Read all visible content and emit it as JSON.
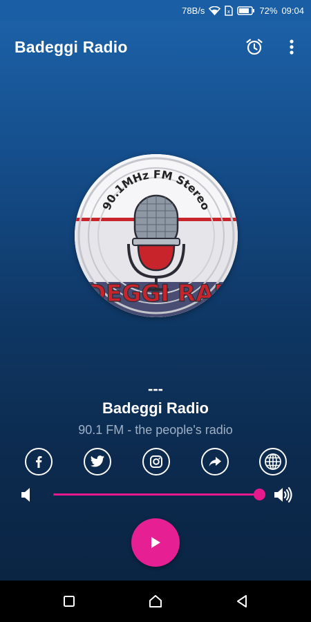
{
  "status_bar": {
    "speed": "78B/s",
    "battery": "72%",
    "time": "09:04"
  },
  "app_bar": {
    "title": "Badeggi Radio",
    "alarm_icon": "alarm-clock-icon",
    "menu_icon": "more-vert-icon"
  },
  "logo": {
    "ring_text": "90.1MHz FM Stereo",
    "wordmark": "BADEGGI RADIO"
  },
  "now_playing": {
    "track": "---",
    "station": "Badeggi Radio",
    "tagline": "90.1 FM - the people's radio"
  },
  "social": [
    {
      "icon": "facebook-icon"
    },
    {
      "icon": "twitter-icon"
    },
    {
      "icon": "instagram-icon"
    },
    {
      "icon": "share-icon"
    },
    {
      "icon": "globe-icon"
    }
  ],
  "volume": {
    "level": 1.0,
    "min_icon": "volume-low-icon",
    "max_icon": "volume-high-icon"
  },
  "player": {
    "play_icon": "play-icon"
  },
  "nav": {
    "recents_icon": "recents-square-icon",
    "home_icon": "home-icon",
    "back_icon": "back-triangle-icon"
  },
  "colors": {
    "accent": "#e61f93",
    "statusbar": "#1a5fa5",
    "background_top": "#1d63aa",
    "background_bottom": "#0a2240",
    "tagline": "#9fb1c7"
  }
}
